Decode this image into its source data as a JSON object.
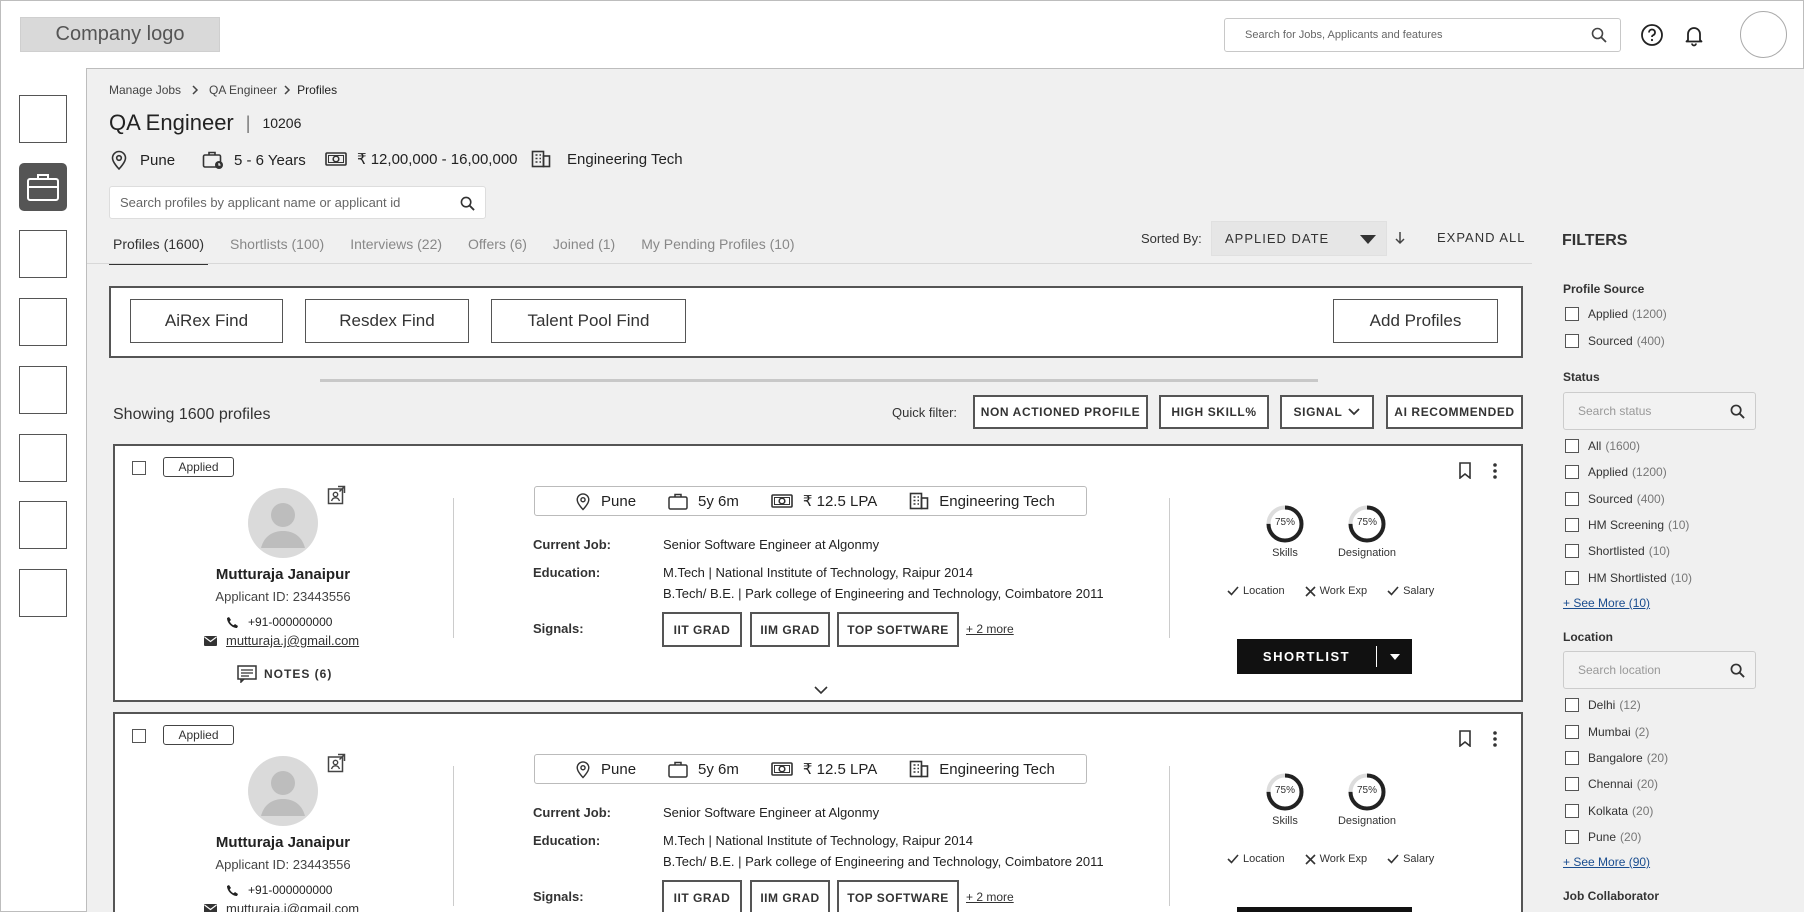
{
  "header": {
    "logo_text": "Company logo",
    "search_placeholder": "Search for Jobs, Applicants and features"
  },
  "breadcrumb": {
    "items": [
      "Manage Jobs",
      "QA Engineer",
      "Profiles"
    ]
  },
  "job": {
    "title": "QA Engineer",
    "id": "10206",
    "location": "Pune",
    "experience": "5 - 6 Years",
    "salary": "₹ 12,00,000 - 16,00,000",
    "department": "Engineering Tech"
  },
  "profile_search": {
    "placeholder": "Search profiles by applicant name or applicant id"
  },
  "tabs": [
    {
      "label": "Profiles",
      "count": "(1600)"
    },
    {
      "label": "Shortlists",
      "count": "(100)"
    },
    {
      "label": "Interviews",
      "count": "(22)"
    },
    {
      "label": "Offers",
      "count": "(6)"
    },
    {
      "label": "Joined",
      "count": "(1)"
    },
    {
      "label": "My Pending Profiles",
      "count": "(10)"
    }
  ],
  "sort": {
    "label": "Sorted By:",
    "value": "APPLIED DATE",
    "expand_all": "EXPAND ALL"
  },
  "find_buttons": [
    "AiRex Find",
    "Resdex Find",
    "Talent Pool Find"
  ],
  "add_profiles": "Add Profiles",
  "showing_text": "Showing 1600 profiles",
  "quick_filter": {
    "label": "Quick filter:",
    "buttons": [
      "NON ACTIONED PROFILE",
      "HIGH SKILL%",
      "SIGNAL",
      "AI RECOMMENDED"
    ]
  },
  "cards": [
    {
      "status": "Applied",
      "name": "Mutturaja Janaipur",
      "applicant_id": "Applicant ID: 23443556",
      "phone": "+91-000000000",
      "email": "mutturaja.j@gmail.com",
      "notes": "NOTES (6)",
      "location": "Pune",
      "experience": "5y 6m",
      "ctc": "₹ 12.5 LPA",
      "department": "Engineering Tech",
      "current_job_label": "Current Job:",
      "current_job": "Senior Software Engineer at Algonmy",
      "education_label": "Education:",
      "education": [
        "M.Tech | National Institute of Technology, Raipur 2014",
        "B.Tech/ B.E. | Park college of Engineering and Technology, Coimbatore 2011"
      ],
      "signals_label": "Signals:",
      "signals": [
        "IIT GRAD",
        "IIM GRAD",
        "TOP SOFTWARE"
      ],
      "signals_more": "+ 2 more",
      "skills_pct": "75%",
      "skills_label": "Skills",
      "designation_pct": "75%",
      "designation_label": "Designation",
      "match": [
        "Location",
        "Work Exp",
        "Salary"
      ],
      "action": "SHORTLIST"
    },
    {
      "status": "Applied",
      "name": "Mutturaja Janaipur",
      "applicant_id": "Applicant ID: 23443556",
      "phone": "+91-000000000",
      "email": "mutturaja.j@gmail.com",
      "location": "Pune",
      "experience": "5y 6m",
      "ctc": "₹ 12.5 LPA",
      "department": "Engineering Tech",
      "current_job_label": "Current Job:",
      "current_job": "Senior Software Engineer at Algonmy",
      "education_label": "Education:",
      "education": [
        "M.Tech | National Institute of Technology, Raipur 2014",
        "B.Tech/ B.E. | Park college of Engineering and Technology, Coimbatore 2011"
      ],
      "signals_label": "Signals:",
      "signals": [
        "IIT GRAD",
        "IIM GRAD",
        "TOP SOFTWARE"
      ],
      "signals_more": "+ 2 more",
      "skills_pct": "75%",
      "skills_label": "Skills",
      "designation_pct": "75%",
      "designation_label": "Designation",
      "match": [
        "Location",
        "Work Exp",
        "Salary"
      ]
    }
  ],
  "filters": {
    "title": "FILTERS",
    "profile_source": {
      "title": "Profile Source",
      "items": [
        {
          "label": "Applied",
          "count": "(1200)"
        },
        {
          "label": "Sourced",
          "count": "(400)"
        }
      ]
    },
    "status": {
      "title": "Status",
      "placeholder": "Search status",
      "items": [
        {
          "label": "All",
          "count": "(1600)"
        },
        {
          "label": "Applied",
          "count": "(1200)"
        },
        {
          "label": "Sourced",
          "count": "(400)"
        },
        {
          "label": "HM Screening",
          "count": "(10)"
        },
        {
          "label": "Shortlisted",
          "count": "(10)"
        },
        {
          "label": "HM Shortlisted",
          "count": "(10)"
        }
      ],
      "see_more": "+ See More (10)"
    },
    "location": {
      "title": "Location",
      "placeholder": "Search location",
      "items": [
        {
          "label": "Delhi",
          "count": "(12)"
        },
        {
          "label": "Mumbai",
          "count": "(2)"
        },
        {
          "label": "Bangalore",
          "count": "(20)"
        },
        {
          "label": "Chennai",
          "count": "(20)"
        },
        {
          "label": "Kolkata",
          "count": "(20)"
        },
        {
          "label": "Pune",
          "count": "(20)"
        }
      ],
      "see_more": "+ See More (90)"
    },
    "job_collaborator": {
      "title": "Job Collaborator"
    }
  }
}
